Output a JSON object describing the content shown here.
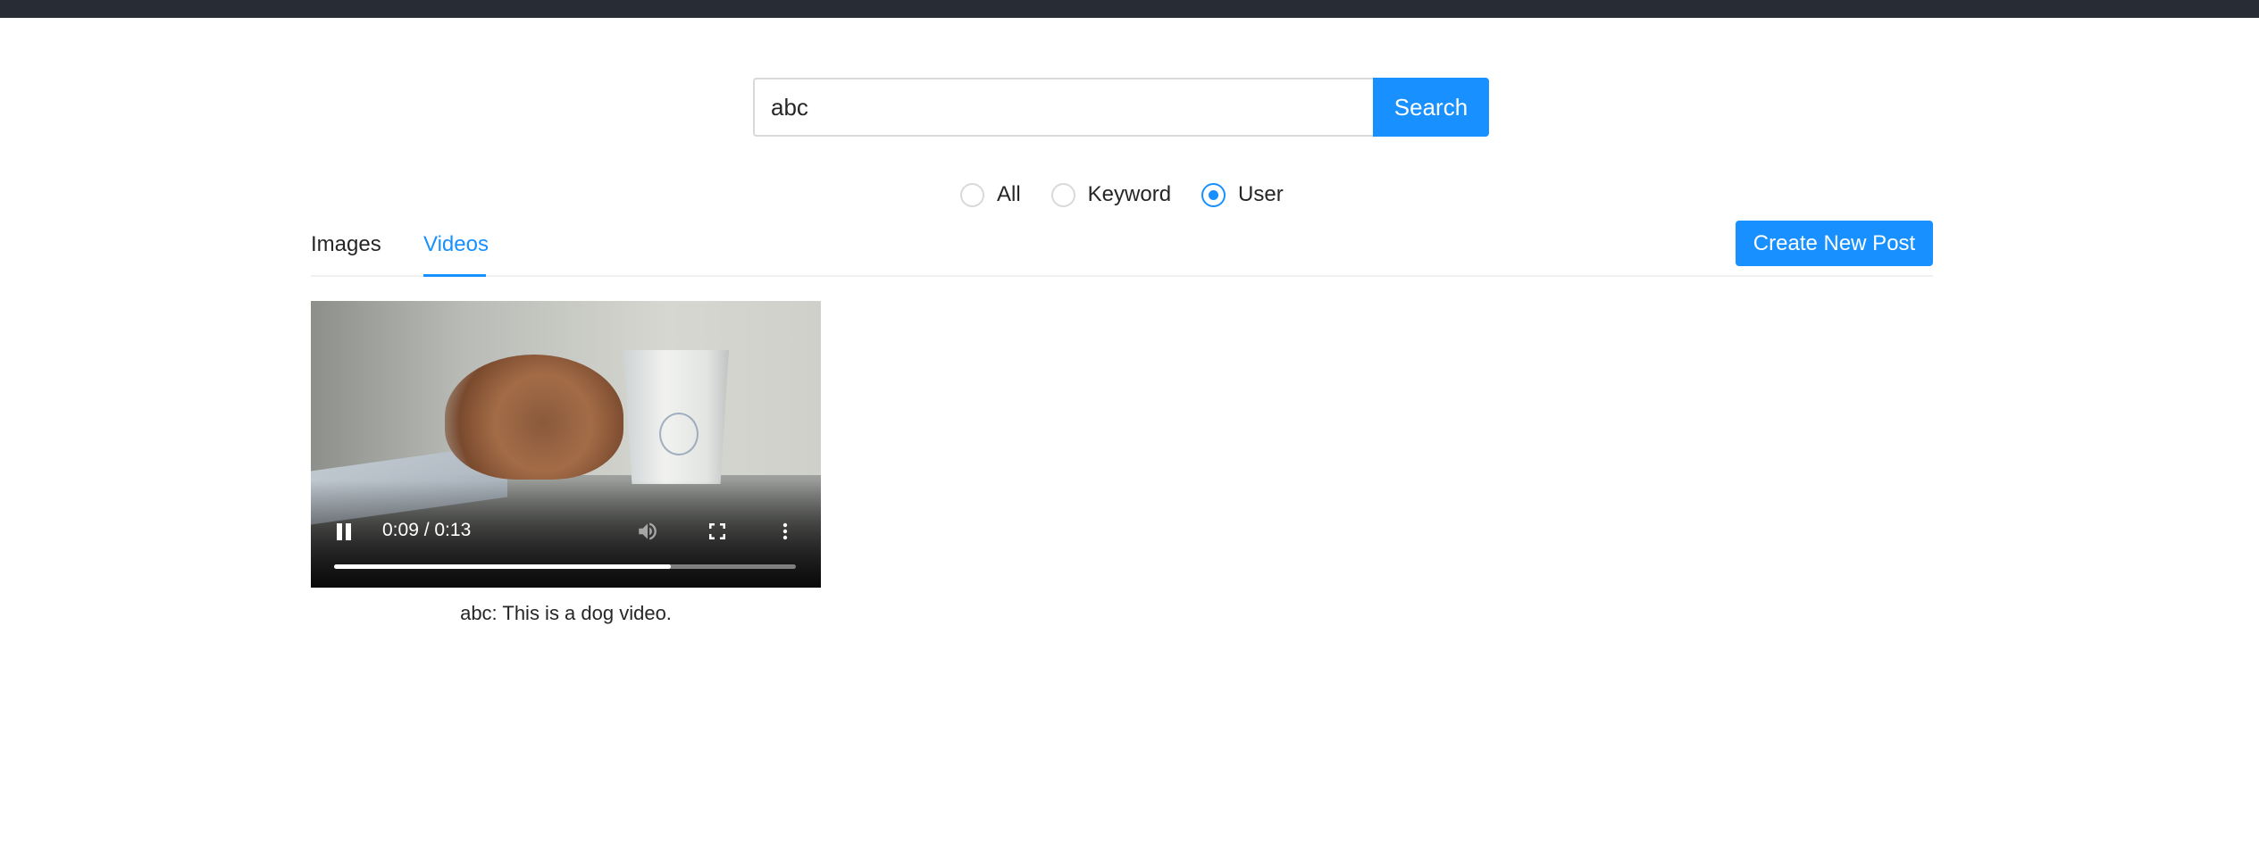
{
  "search": {
    "value": "abc",
    "button_label": "Search"
  },
  "filter": {
    "options": [
      {
        "label": "All",
        "checked": false
      },
      {
        "label": "Keyword",
        "checked": false
      },
      {
        "label": "User",
        "checked": true
      }
    ]
  },
  "tabs": {
    "items": [
      {
        "label": "Images",
        "active": false
      },
      {
        "label": "Videos",
        "active": true
      }
    ],
    "create_button_label": "Create New Post"
  },
  "accent_color": "#1890ff",
  "videos": [
    {
      "time": "0:09 / 0:13",
      "progress_fraction": 0.73,
      "caption": "abc: This is a dog video.",
      "controls": [
        "pause-icon",
        "volume-icon",
        "fullscreen-icon",
        "more-vert-icon"
      ]
    }
  ]
}
